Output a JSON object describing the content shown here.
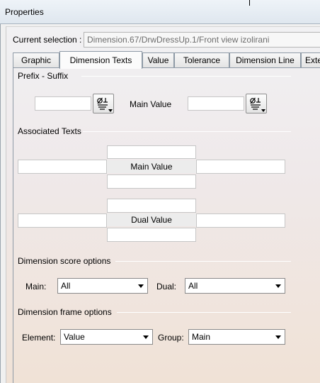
{
  "window": {
    "title": "Properties"
  },
  "selection": {
    "label": "Current selection :",
    "value": "Dimension.67/DrwDressUp.1/Front view izolirani"
  },
  "tabs": [
    {
      "label": "Graphic"
    },
    {
      "label": "Dimension Texts",
      "active": true
    },
    {
      "label": "Value"
    },
    {
      "label": "Tolerance"
    },
    {
      "label": "Dimension Line"
    },
    {
      "label": "Exte"
    }
  ],
  "prefix_suffix": {
    "heading": "Prefix - Suffix",
    "main_value_label": "Main Value",
    "prefix_value": "",
    "suffix_value": ""
  },
  "associated_texts": {
    "heading": "Associated Texts",
    "main_value_label": "Main Value",
    "dual_value_label": "Dual Value"
  },
  "score_options": {
    "heading": "Dimension score options",
    "main_label": "Main:",
    "main_value": "All",
    "dual_label": "Dual:",
    "dual_value": "All"
  },
  "frame_options": {
    "heading": "Dimension frame options",
    "element_label": "Element:",
    "element_value": "Value",
    "group_label": "Group:",
    "group_value": "Main"
  },
  "icons": {
    "symbol_button": "insert-symbol-icon",
    "combo_arrow": "chevron-down-icon"
  }
}
